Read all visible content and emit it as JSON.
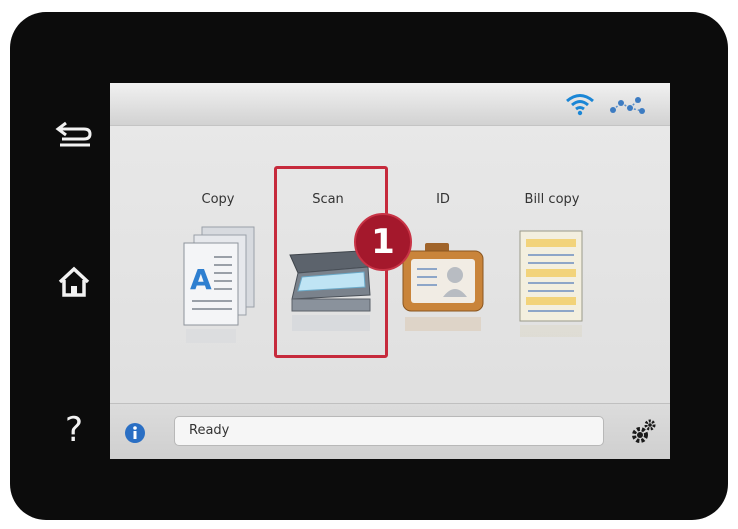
{
  "hardware": {
    "help_label": "?"
  },
  "status_bar": {
    "icons": [
      "wifi-icon",
      "network-icon"
    ],
    "wifi_color": "#1a86d6"
  },
  "functions": [
    {
      "label": "Copy",
      "icon": "copy-icon"
    },
    {
      "label": "Scan",
      "icon": "scanner-icon"
    },
    {
      "label": "ID",
      "icon": "id-card-icon"
    },
    {
      "label": "Bill copy",
      "icon": "bill-copy-icon"
    }
  ],
  "callout": {
    "number": "1",
    "color": "#a4182c"
  },
  "bottom_bar": {
    "status": "Ready",
    "info_icon": "info-icon",
    "settings_icon": "settings-icon",
    "info_color": "#2a6fc4"
  }
}
